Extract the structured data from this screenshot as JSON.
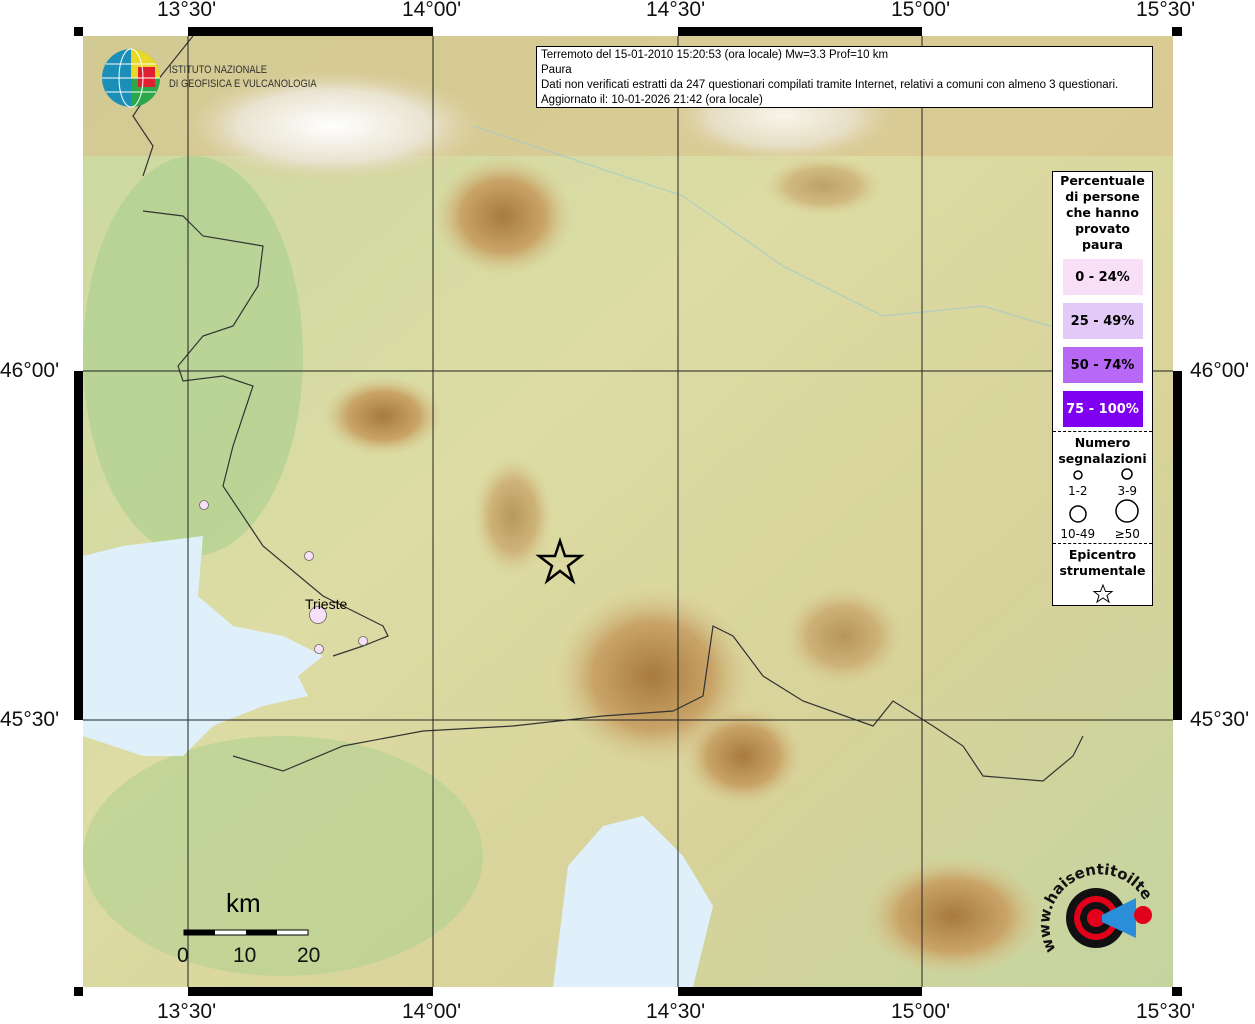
{
  "axes": {
    "lon_ticks": [
      "13°30'",
      "14°00'",
      "14°30'",
      "15°00'",
      "15°30'"
    ],
    "lat_ticks": [
      "46°00'",
      "45°30'"
    ]
  },
  "info": {
    "line1": "Terremoto del 15-01-2010 15:20:53 (ora locale) Mw=3.3 Prof=10 km",
    "line2": "Paura",
    "line3": "Dati non verificati estratti da 247 questionari compilati tramite Internet, relativi a comuni con almeno 3 questionari.",
    "line4": "Aggiornato il: 10-01-2026 21:42 (ora locale)"
  },
  "logo_ingv": {
    "line1": "ISTITUTO NAZIONALE",
    "line2": "DI GEOFISICA E VULCANOLOGIA"
  },
  "logo_hsit": {
    "text": "www.haisentitoilterremoto.it"
  },
  "legend": {
    "title": "Percentuale di persone che hanno provato paura",
    "classes": [
      {
        "label": "0 - 24%",
        "color": "#f8dff8"
      },
      {
        "label": "25 - 49%",
        "color": "#e2c9f7"
      },
      {
        "label": "50 - 74%",
        "color": "#b768f5"
      },
      {
        "label": "75 - 100%",
        "color": "#7f00f0"
      }
    ],
    "count_title": "Numero segnalazioni",
    "counts": [
      "1-2",
      "3-9",
      "10-49",
      "≥50"
    ],
    "epi_title": "Epicentro strumentale"
  },
  "places": [
    {
      "name": "Trieste"
    }
  ],
  "points": [
    {
      "class": 0,
      "size": "3-9"
    },
    {
      "class": 0,
      "size": "3-9"
    },
    {
      "class": 0,
      "size": "10-49"
    },
    {
      "class": 0,
      "size": "3-9"
    },
    {
      "class": 0,
      "size": "3-9"
    }
  ],
  "scale": {
    "unit": "km",
    "labels": [
      "0",
      "10",
      "20"
    ]
  },
  "colors": {
    "sea": "#dff0fb",
    "border": "#333333"
  }
}
